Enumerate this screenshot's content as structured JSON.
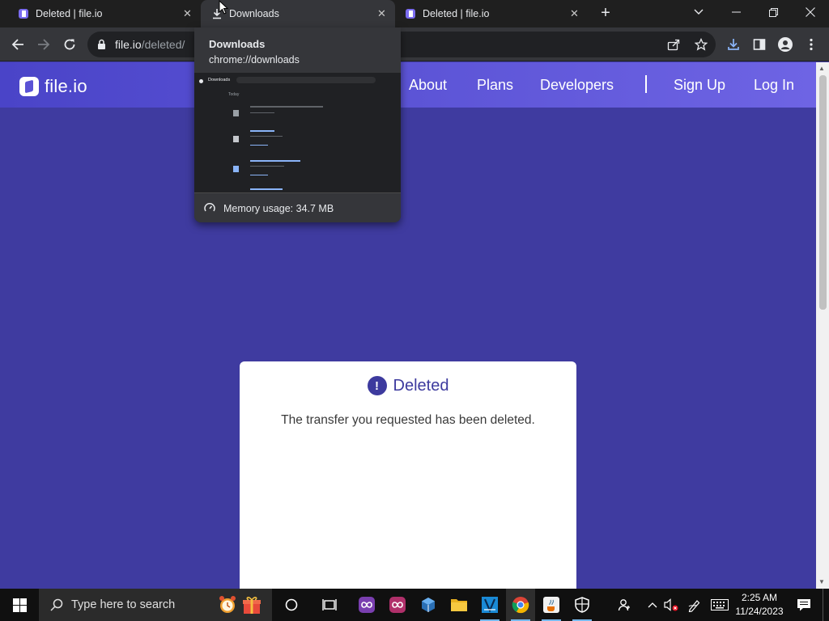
{
  "browser": {
    "tabs": [
      {
        "label": "Deleted | file.io",
        "state": "inactive"
      },
      {
        "label": "Downloads",
        "state": "active"
      },
      {
        "label": "Deleted | file.io",
        "state": "inactive"
      }
    ],
    "url_host": "file.io",
    "url_path": "/deleted/"
  },
  "hover_card": {
    "title": "Downloads",
    "url": "chrome://downloads",
    "memory": "Memory usage: 34.7 MB",
    "preview_header": "Downloads",
    "preview_section": "Today"
  },
  "site": {
    "logo_text": "file.io",
    "nav": {
      "about": "About",
      "plans": "Plans",
      "developers": "Developers",
      "sign_up": "Sign Up",
      "log_in": "Log In"
    },
    "card": {
      "title": "Deleted",
      "message": "The transfer you requested has been deleted."
    }
  },
  "taskbar": {
    "search_placeholder": "Type here to search",
    "time": "2:25 AM",
    "date": "11/24/2023"
  },
  "colors": {
    "page_bg": "#3f3ba0",
    "accent": "#3d3a9e",
    "nav_gradient_start": "#4a44c8",
    "nav_gradient_end": "#6e64e4",
    "tabstrip": "#1f1f1f",
    "toolbar": "#35363a"
  }
}
